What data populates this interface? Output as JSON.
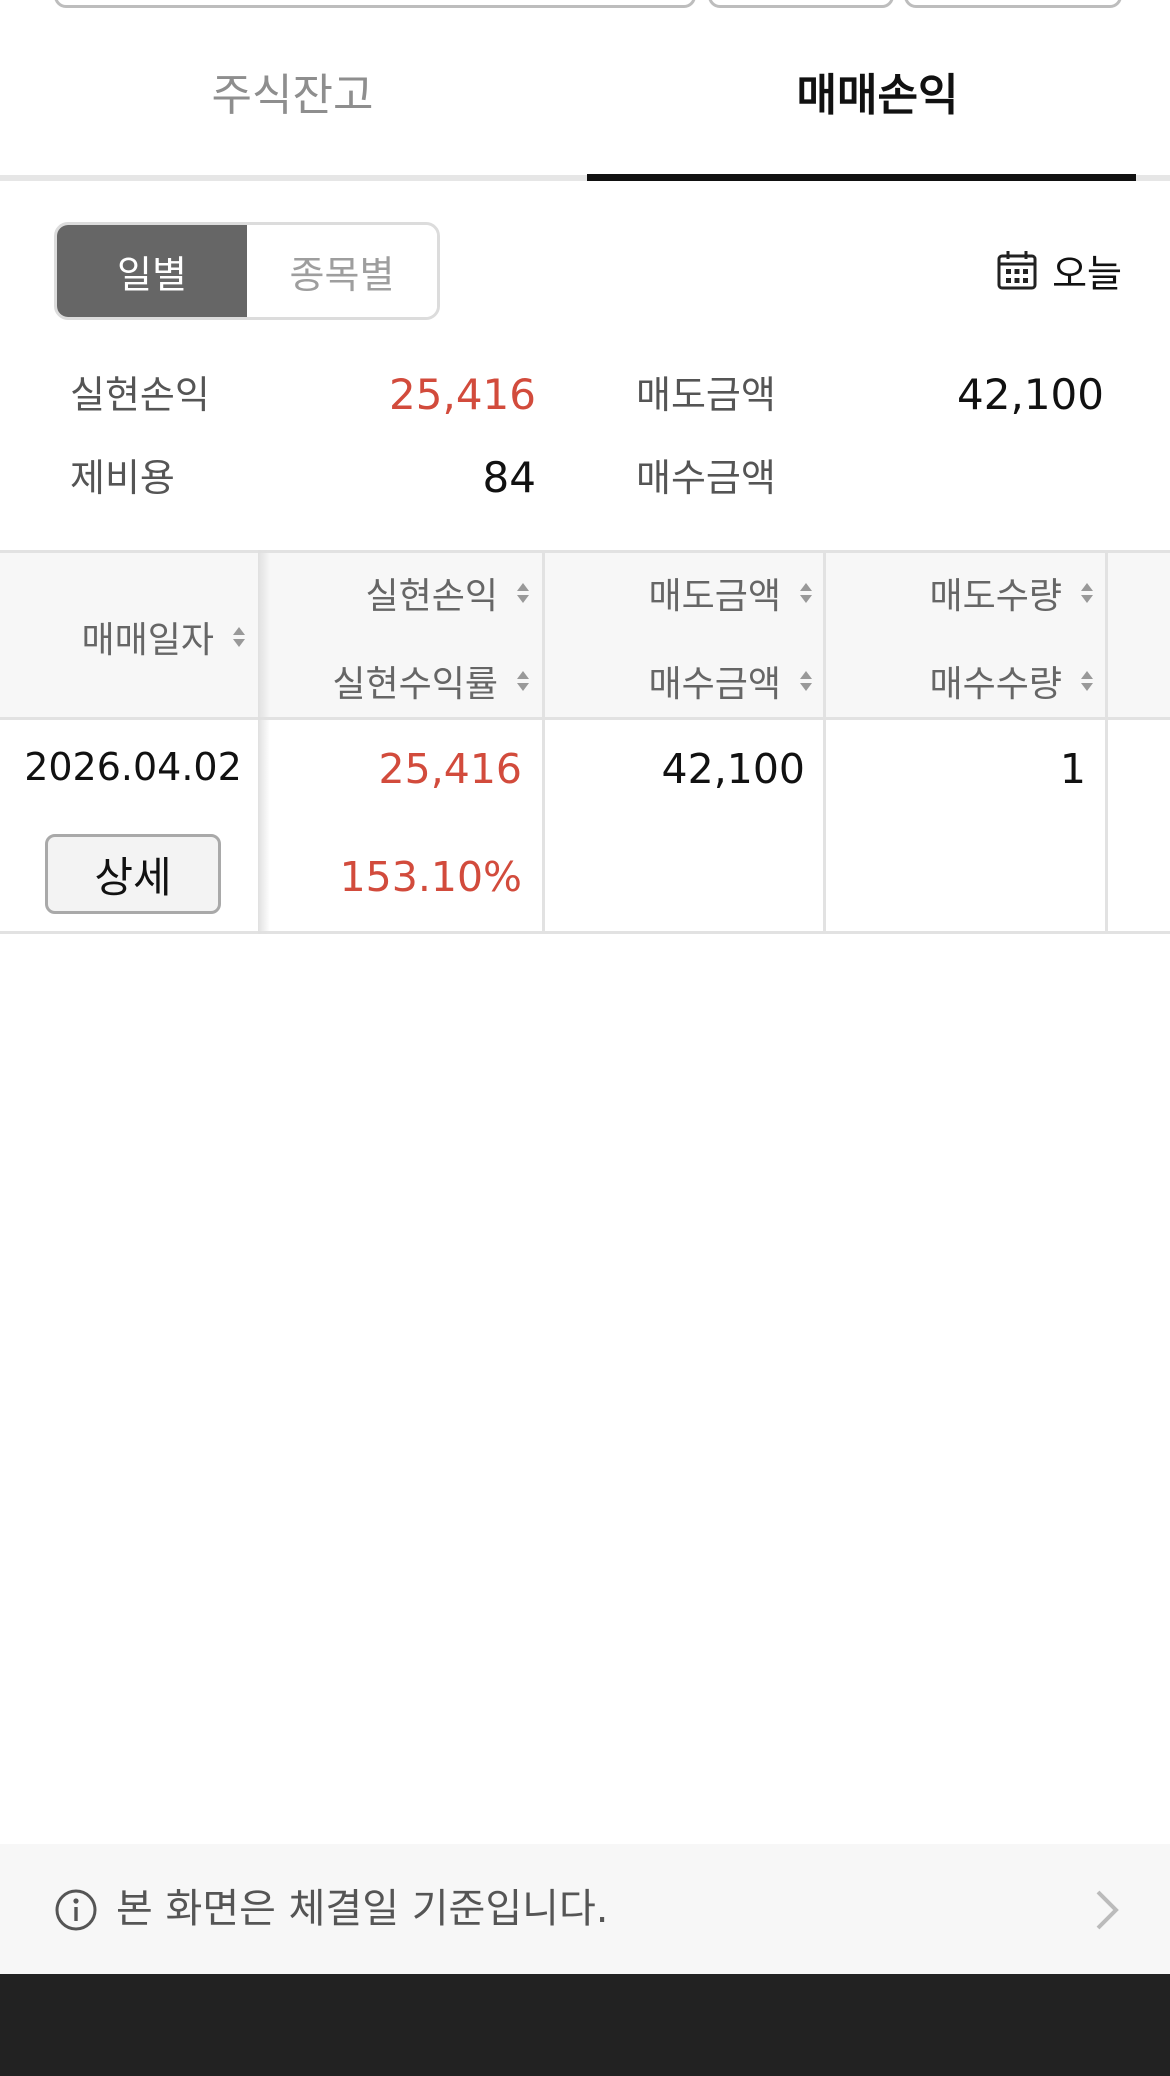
{
  "tabs": [
    {
      "label": "주식잔고",
      "active": false
    },
    {
      "label": "매매손익",
      "active": true
    }
  ],
  "segment": {
    "daily": "일별",
    "by_item": "종목별",
    "selected": "일별"
  },
  "date_filter": {
    "label": "오늘",
    "icon": "calendar-icon"
  },
  "summary": {
    "realized_pl_label": "실현손익",
    "realized_pl_value": "25,416",
    "sell_amount_label": "매도금액",
    "sell_amount_value": "42,100",
    "fees_label": "제비용",
    "fees_value": "84",
    "buy_amount_label": "매수금액",
    "buy_amount_value": ""
  },
  "table": {
    "headers": {
      "trade_date": "매매일자",
      "realized_pl": "실현손익",
      "realized_rate": "실현수익률",
      "sell_amount": "매도금액",
      "buy_amount": "매수금액",
      "sell_qty": "매도수량",
      "buy_qty": "매수수량"
    },
    "rows": [
      {
        "trade_date": "2026.04.02",
        "detail_label": "상세",
        "realized_pl": "25,416",
        "realized_rate": "153.10%",
        "sell_amount": "42,100",
        "buy_amount": "",
        "sell_qty": "1",
        "buy_qty": ""
      }
    ]
  },
  "info": {
    "text": "본 화면은 체결일 기준입니다.",
    "icon": "info-icon"
  },
  "colors": {
    "profit": "#d24b3c",
    "active_segment": "#666666",
    "tab_indicator": "#111111"
  }
}
